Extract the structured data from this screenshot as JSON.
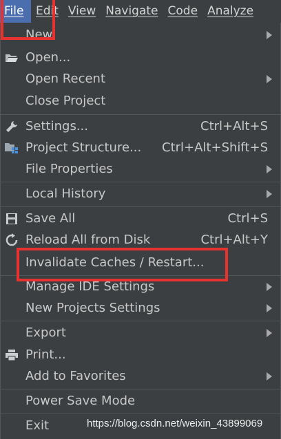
{
  "menubar": {
    "items": [
      {
        "label": "File"
      },
      {
        "label": "Edit"
      },
      {
        "label": "View"
      },
      {
        "label": "Navigate"
      },
      {
        "label": "Code"
      },
      {
        "label": "Analyze"
      }
    ]
  },
  "file_menu": {
    "items": [
      {
        "label": "New",
        "icon": "none",
        "shortcut": "",
        "submenu": true
      },
      {
        "label": "Open...",
        "icon": "folder-icon",
        "shortcut": "",
        "submenu": false
      },
      {
        "label": "Open Recent",
        "icon": "none",
        "shortcut": "",
        "submenu": true
      },
      {
        "label": "Close Project",
        "icon": "none",
        "shortcut": "",
        "submenu": false
      },
      {
        "label": "Settings...",
        "icon": "wrench-icon",
        "shortcut": "Ctrl+Alt+S",
        "submenu": false
      },
      {
        "label": "Project Structure...",
        "icon": "project-structure-icon",
        "shortcut": "Ctrl+Alt+Shift+S",
        "submenu": false
      },
      {
        "label": "File Properties",
        "icon": "none",
        "shortcut": "",
        "submenu": true
      },
      {
        "label": "Local History",
        "icon": "none",
        "shortcut": "",
        "submenu": true
      },
      {
        "label": "Save All",
        "icon": "save-icon",
        "shortcut": "Ctrl+S",
        "submenu": false
      },
      {
        "label": "Reload All from Disk",
        "icon": "reload-icon",
        "shortcut": "Ctrl+Alt+Y",
        "submenu": false
      },
      {
        "label": "Invalidate Caches / Restart...",
        "icon": "none",
        "shortcut": "",
        "submenu": false
      },
      {
        "label": "Manage IDE Settings",
        "icon": "none",
        "shortcut": "",
        "submenu": true
      },
      {
        "label": "New Projects Settings",
        "icon": "none",
        "shortcut": "",
        "submenu": true
      },
      {
        "label": "Export",
        "icon": "none",
        "shortcut": "",
        "submenu": true
      },
      {
        "label": "Print...",
        "icon": "printer-icon",
        "shortcut": "",
        "submenu": false
      },
      {
        "label": "Add to Favorites",
        "icon": "none",
        "shortcut": "",
        "submenu": true
      },
      {
        "label": "Power Save Mode",
        "icon": "none",
        "shortcut": "",
        "submenu": false
      },
      {
        "label": "Exit",
        "icon": "none",
        "shortcut": "",
        "submenu": false
      }
    ]
  },
  "watermark": "https://blog.csdn.net/weixin_43899069",
  "colors": {
    "background": "#3c3f41",
    "active_menu": "#4b6eaf",
    "highlight_box": "#e8322f",
    "text": "#c8c8c8"
  }
}
